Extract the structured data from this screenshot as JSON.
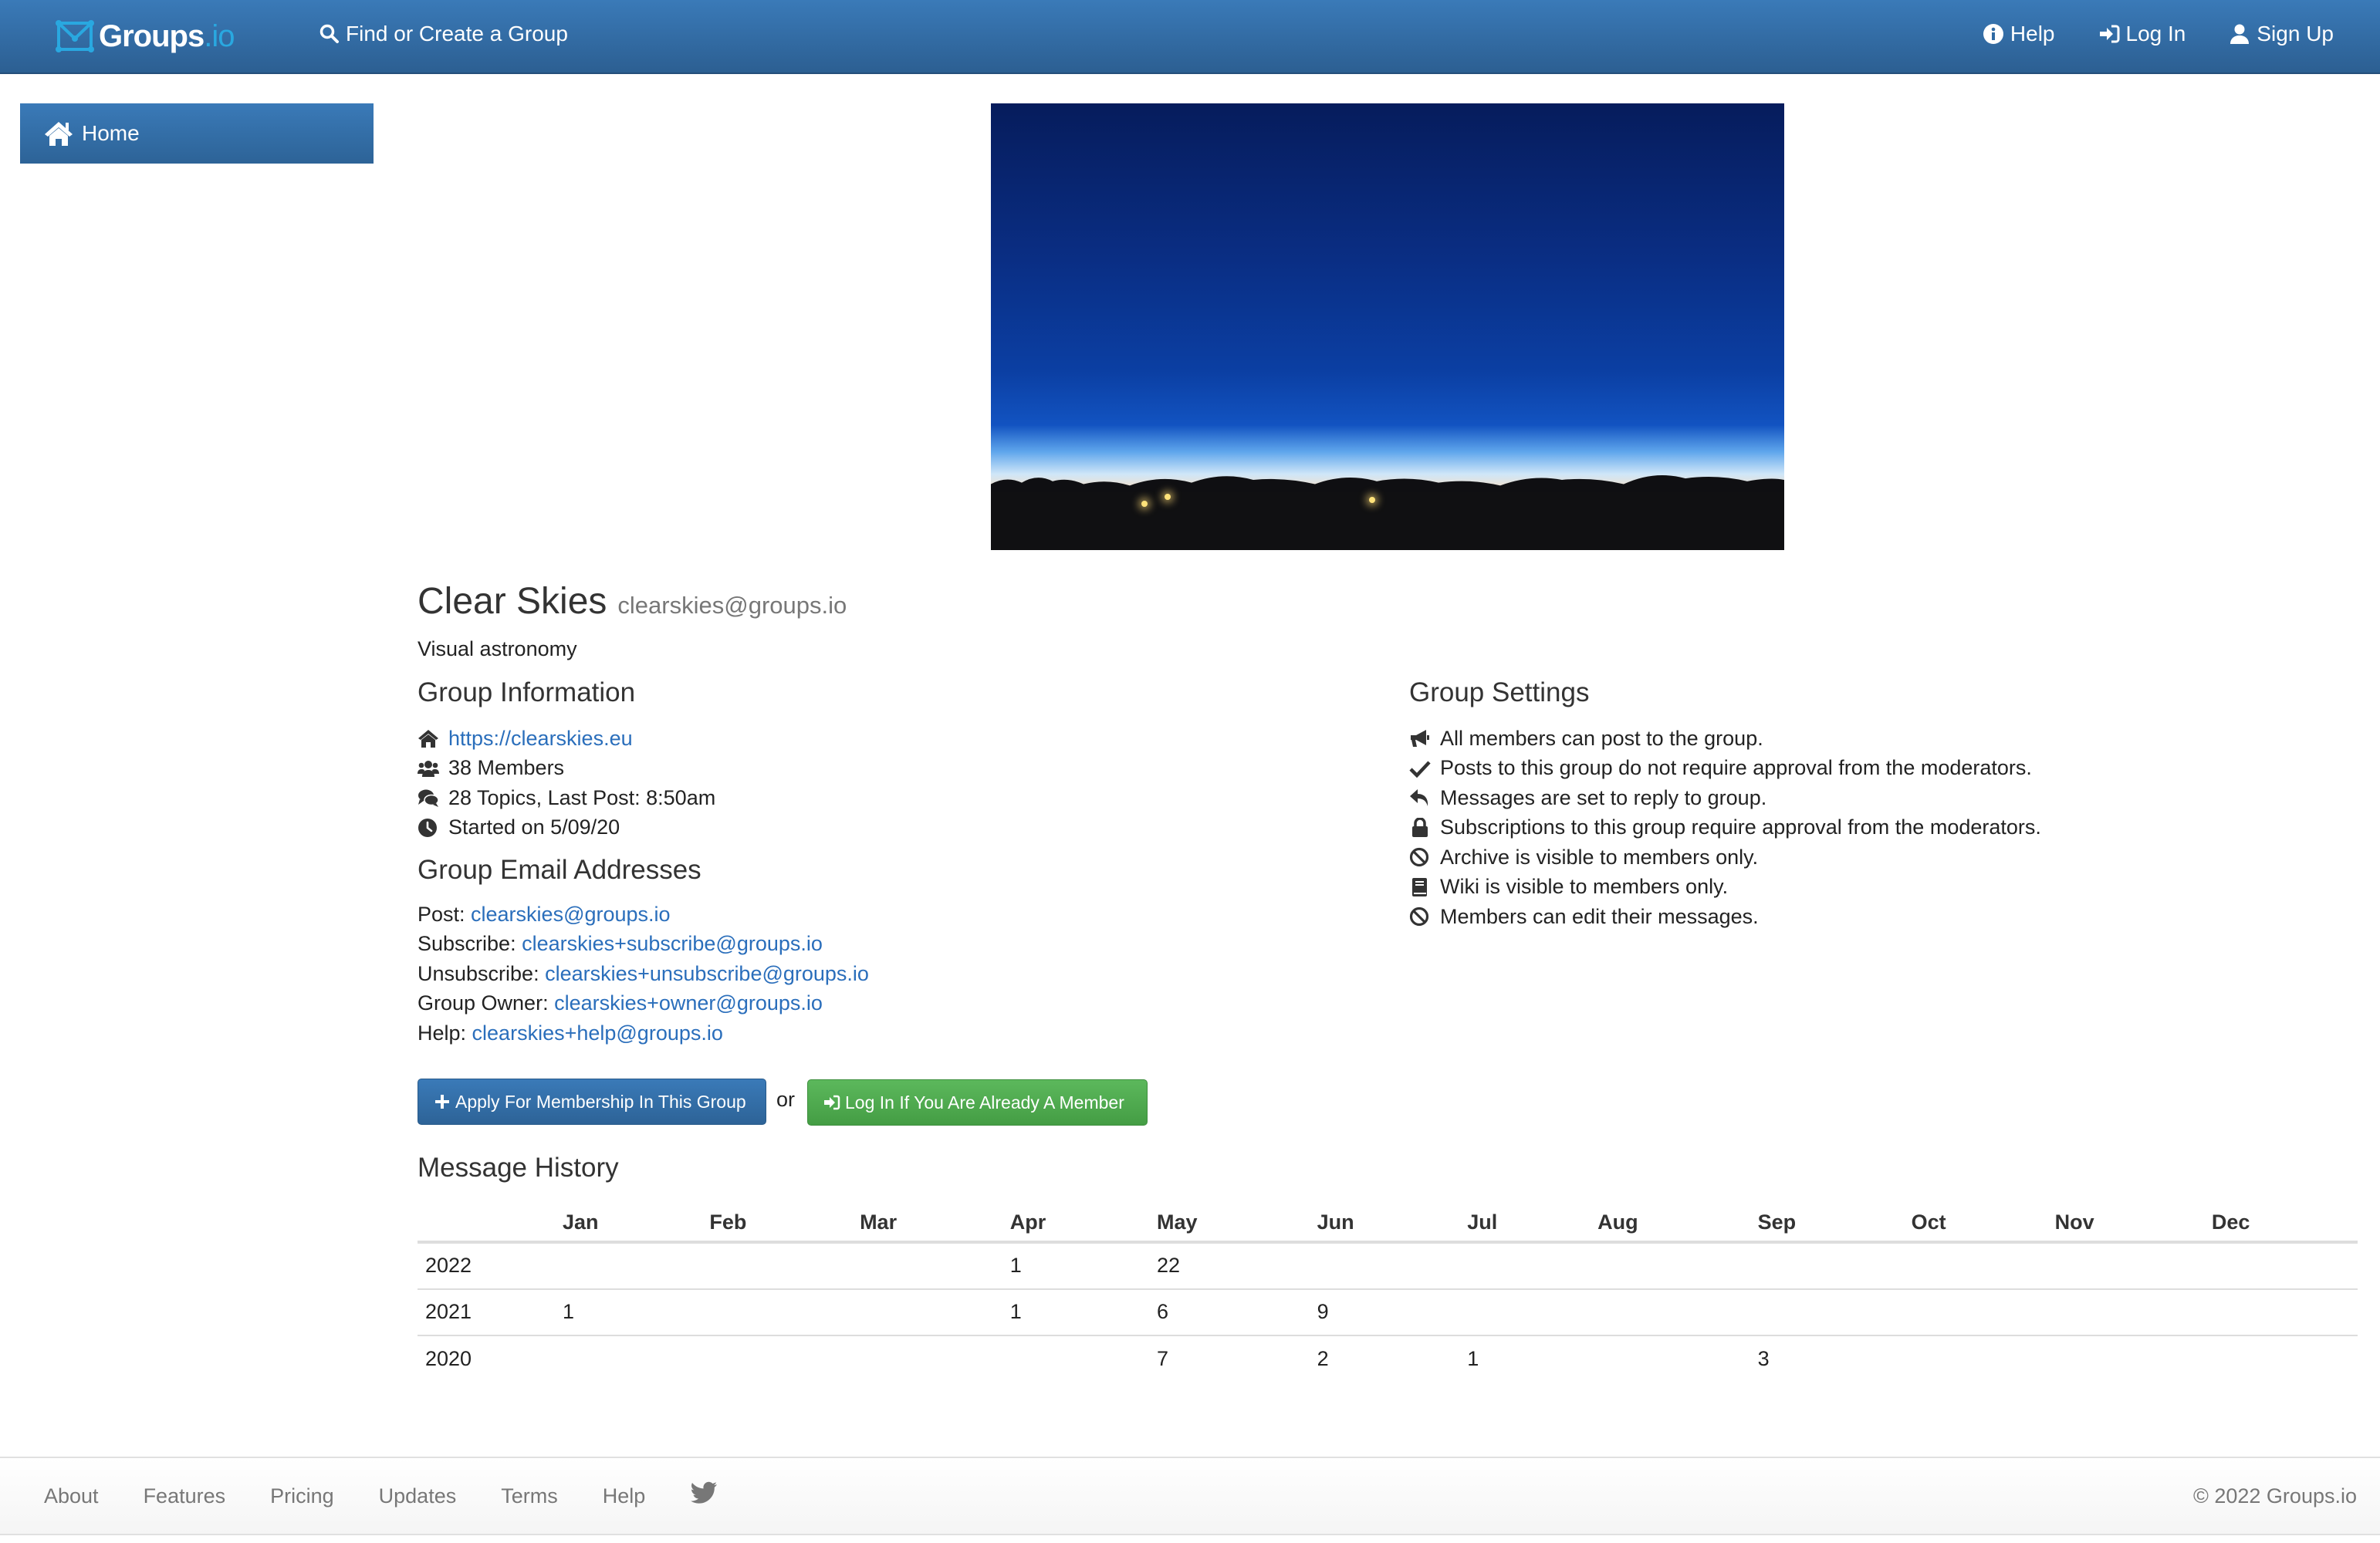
{
  "header": {
    "brand": "Groups",
    "brand_suffix": ".io",
    "find_label": "Find or Create a Group",
    "help_label": "Help",
    "login_label": "Log In",
    "signup_label": "Sign Up"
  },
  "sidebar": {
    "items": [
      {
        "label": "Home",
        "icon": "home-icon",
        "active": true
      }
    ]
  },
  "banner": {
    "alt": "Night sky with noctilucent clouds over rooftops"
  },
  "group": {
    "name": "Clear Skies",
    "email": "clearskies@groups.io",
    "description": "Visual astronomy"
  },
  "info": {
    "heading": "Group Information",
    "website": "https://clearskies.eu",
    "members": "38 Members",
    "topics": "28 Topics, Last Post: 8:50am",
    "started": "Started on 5/09/20"
  },
  "emails": {
    "heading": "Group Email Addresses",
    "rows": [
      {
        "label": "Post: ",
        "address": "clearskies@groups.io"
      },
      {
        "label": "Subscribe: ",
        "address": "clearskies+subscribe@groups.io"
      },
      {
        "label": "Unsubscribe: ",
        "address": "clearskies+unsubscribe@groups.io"
      },
      {
        "label": "Group Owner: ",
        "address": "clearskies+owner@groups.io"
      },
      {
        "label": "Help: ",
        "address": "clearskies+help@groups.io"
      }
    ]
  },
  "settings": {
    "heading": "Group Settings",
    "items": [
      {
        "icon": "bullhorn-icon",
        "text": "All members can post to the group."
      },
      {
        "icon": "checkmark-icon",
        "text": "Posts to this group do not require approval from the moderators."
      },
      {
        "icon": "reply-icon",
        "text": "Messages are set to reply to group."
      },
      {
        "icon": "lock-icon",
        "text": "Subscriptions to this group require approval from the moderators."
      },
      {
        "icon": "ban-icon",
        "text": "Archive is visible to members only."
      },
      {
        "icon": "book-icon",
        "text": "Wiki is visible to members only."
      },
      {
        "icon": "ban-icon",
        "text": "Members can edit their messages."
      }
    ]
  },
  "actions": {
    "apply_label": "Apply For Membership In This Group",
    "or_label": "or",
    "login_label": "Log In If You Are Already A Member",
    "apply_color": "#337ab7",
    "login_color": "#5cb85c"
  },
  "history": {
    "heading": "Message History",
    "months": [
      "Jan",
      "Feb",
      "Mar",
      "Apr",
      "May",
      "Jun",
      "Jul",
      "Aug",
      "Sep",
      "Oct",
      "Nov",
      "Dec"
    ],
    "rows": [
      {
        "year": "2022",
        "counts": [
          "",
          "",
          "",
          "1",
          "22",
          "",
          "",
          "",
          "",
          "",
          "",
          ""
        ]
      },
      {
        "year": "2021",
        "counts": [
          "1",
          "",
          "",
          "1",
          "6",
          "9",
          "",
          "",
          "",
          "",
          "",
          ""
        ]
      },
      {
        "year": "2020",
        "counts": [
          "",
          "",
          "",
          "",
          "7",
          "2",
          "1",
          "",
          "3",
          "",
          "",
          ""
        ]
      }
    ]
  },
  "footer": {
    "links": [
      "About",
      "Features",
      "Pricing",
      "Updates",
      "Terms",
      "Help"
    ],
    "copyright": "© 2022 Groups.io"
  }
}
